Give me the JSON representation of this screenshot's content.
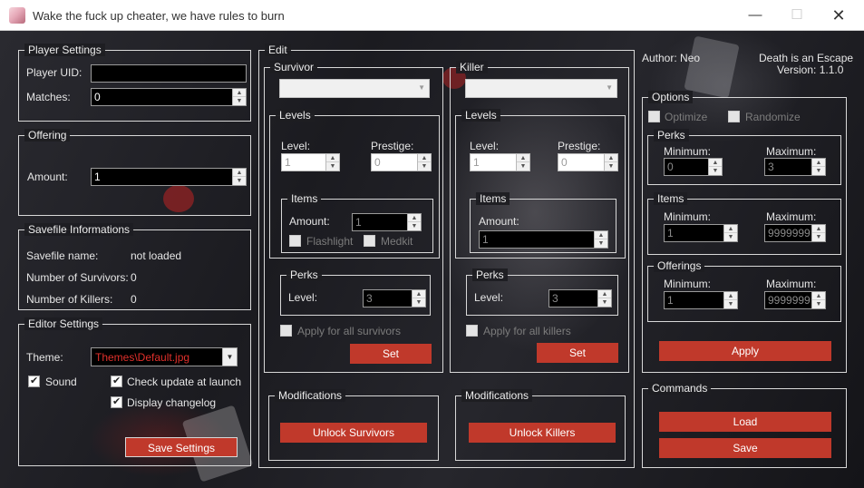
{
  "window": {
    "title": "Wake the fuck up cheater, we have rules to burn",
    "min_glyph": "—",
    "max_glyph": "☐",
    "close_glyph": "✕"
  },
  "player": {
    "legend": "Player Settings",
    "uid_label": "Player UID:",
    "uid_value": "",
    "matches_label": "Matches:",
    "matches_value": "0"
  },
  "offering": {
    "legend": "Offering",
    "amount_label": "Amount:",
    "amount_value": "1"
  },
  "savefile": {
    "legend": "Savefile Informations",
    "name_label": "Savefile name:",
    "name_value": "not loaded",
    "survivors_label": "Number of Survivors:",
    "survivors_value": "0",
    "killers_label": "Number of Killers:",
    "killers_value": "0"
  },
  "editor": {
    "legend": "Editor Settings",
    "theme_label": "Theme:",
    "theme_value": "Themes\\Default.jpg",
    "sound_label": "Sound",
    "sound_checked": true,
    "update_label": "Check update at launch",
    "update_checked": true,
    "changelog_label": "Display changelog",
    "changelog_checked": true,
    "save_label": "Save Settings"
  },
  "edit": {
    "legend": "Edit",
    "survivor": {
      "legend": "Survivor",
      "selected": "",
      "levels": {
        "legend": "Levels",
        "level_label": "Level:",
        "level_value": "1",
        "prestige_label": "Prestige:",
        "prestige_value": "0"
      },
      "items": {
        "legend": "Items",
        "amount_label": "Amount:",
        "amount_value": "1",
        "flashlight_label": "Flashlight",
        "medkit_label": "Medkit"
      },
      "perks": {
        "legend": "Perks",
        "level_label": "Level:",
        "level_value": "3"
      },
      "apply_all_label": "Apply for all survivors",
      "set_label": "Set"
    },
    "killer": {
      "legend": "Killer",
      "selected": "",
      "levels": {
        "legend": "Levels",
        "level_label": "Level:",
        "level_value": "1",
        "prestige_label": "Prestige:",
        "prestige_value": "0"
      },
      "items": {
        "legend": "Items",
        "amount_label": "Amount:",
        "amount_value": "1"
      },
      "perks": {
        "legend": "Perks",
        "level_label": "Level:",
        "level_value": "3"
      },
      "apply_all_label": "Apply for all killers",
      "set_label": "Set"
    }
  },
  "modifications": {
    "survivor": {
      "legend": "Modifications",
      "button": "Unlock Survivors"
    },
    "killer": {
      "legend": "Modifications",
      "button": "Unlock Killers"
    }
  },
  "info": {
    "author": "Author: Neo",
    "app_name": "Death is an Escape",
    "version": "Version:  1.1.0"
  },
  "options": {
    "legend": "Options",
    "optimize_label": "Optimize",
    "randomize_label": "Randomize",
    "perks": {
      "legend": "Perks",
      "min_label": "Minimum:",
      "min_value": "0",
      "max_label": "Maximum:",
      "max_value": "3"
    },
    "items": {
      "legend": "Items",
      "min_label": "Minimum:",
      "min_value": "1",
      "max_label": "Maximum:",
      "max_value": "9999999"
    },
    "offerings": {
      "legend": "Offerings",
      "min_label": "Minimum:",
      "min_value": "1",
      "max_label": "Maximum:",
      "max_value": "9999999"
    },
    "apply_label": "Apply"
  },
  "commands": {
    "legend": "Commands",
    "load_label": "Load",
    "save_label": "Save"
  },
  "icons": {
    "app": "app-icon",
    "spin_up": "▲",
    "spin_down": "▼",
    "dropdown": "▼"
  },
  "colors": {
    "accent": "#c0392b",
    "theme_text": "#e0302b",
    "panel_border": "#d8d8d8"
  }
}
